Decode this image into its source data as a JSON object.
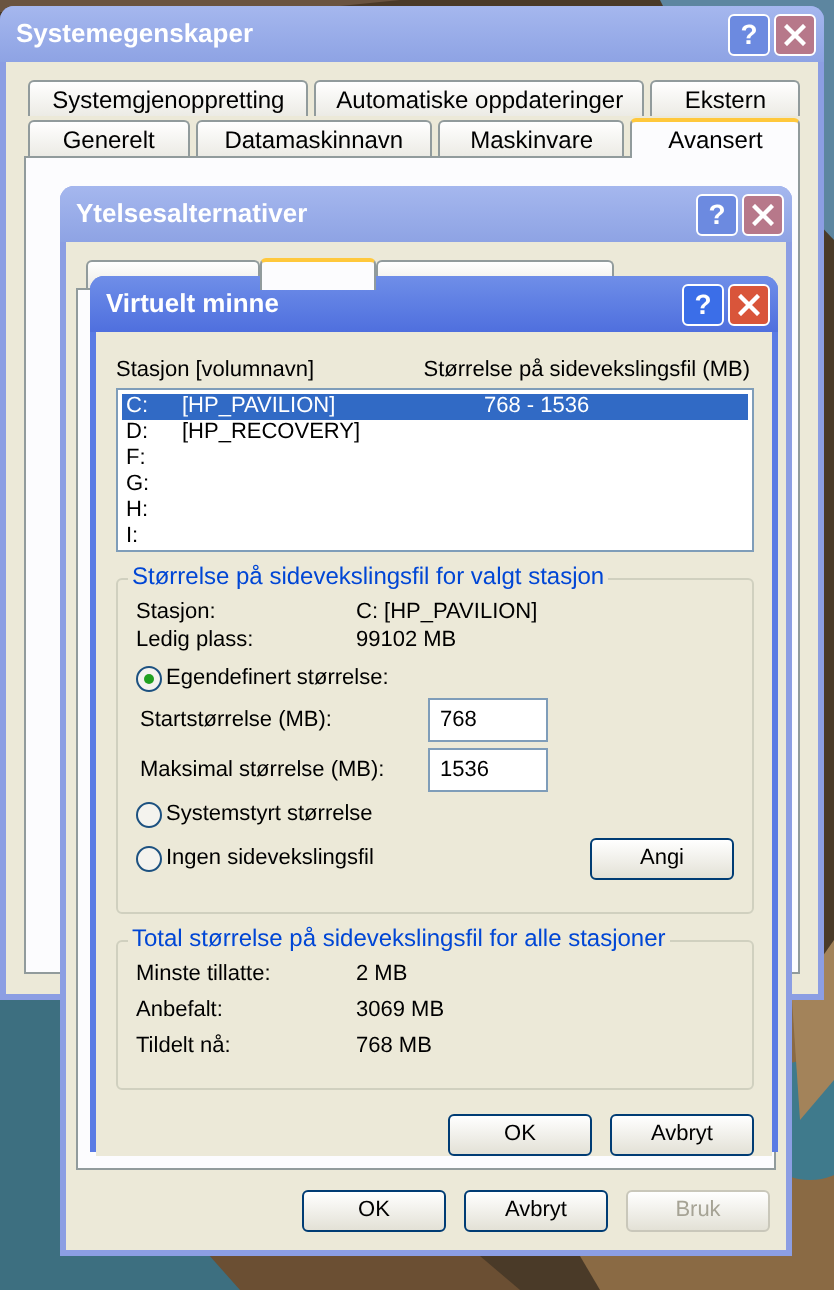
{
  "system_properties": {
    "title": "Systemegenskaper",
    "active": false,
    "help_button": "?",
    "tab_rows": [
      [
        {
          "label": "Systemgjenoppretting",
          "selected": false
        },
        {
          "label": "Automatiske oppdateringer",
          "selected": false
        },
        {
          "label": "Ekstern",
          "selected": false
        }
      ],
      [
        {
          "label": "Generelt",
          "selected": false
        },
        {
          "label": "Datamaskinnavn",
          "selected": false
        },
        {
          "label": "Maskinvare",
          "selected": false
        },
        {
          "label": "Avansert",
          "selected": true
        }
      ]
    ]
  },
  "performance_options": {
    "title": "Ytelsesalternativer",
    "active": false,
    "help_button": "?",
    "tabs": [
      {
        "selected": false
      },
      {
        "selected": true
      },
      {
        "selected": false
      }
    ],
    "buttons": [
      {
        "label": "OK",
        "disabled": false
      },
      {
        "label": "Avbryt",
        "disabled": false
      },
      {
        "label": "Bruk",
        "disabled": true
      }
    ]
  },
  "virtual_memory": {
    "title": "Virtuelt minne",
    "active": true,
    "help_button": "?",
    "columns": [
      "Stasjon [volumnavn]",
      "Størrelse på sidevekslingsfil (MB)"
    ],
    "drives": [
      {
        "drive": "C:",
        "volume": "[HP_PAVILION]",
        "size": "768 - 1536",
        "selected": true
      },
      {
        "drive": "D:",
        "volume": "[HP_RECOVERY]",
        "selected": false
      },
      {
        "drive": "F:",
        "selected": false
      },
      {
        "drive": "G:",
        "selected": false
      },
      {
        "drive": "H:",
        "selected": false
      },
      {
        "drive": "I:",
        "selected": false
      }
    ],
    "selected_drive_group": {
      "title": "Størrelse på sidevekslingsfil for valgt stasjon",
      "info": [
        {
          "label": "Stasjon:",
          "value": "C:  [HP_PAVILION]"
        },
        {
          "label": "Ledig plass:",
          "value": "99102 MB"
        }
      ],
      "options": [
        {
          "label": "Egendefinert størrelse:",
          "selected": true,
          "fields": [
            {
              "label": "Startstørrelse (MB):",
              "value": "768"
            },
            {
              "label": "Maksimal størrelse (MB):",
              "value": "1536"
            }
          ]
        },
        {
          "label": "Systemstyrt størrelse",
          "selected": false
        },
        {
          "label": "Ingen sidevekslingsfil",
          "selected": false
        }
      ],
      "set_button": "Angi"
    },
    "total_group": {
      "title": "Total størrelse på sidevekslingsfil for alle stasjoner",
      "info": [
        {
          "label": "Minste tillatte:",
          "value": "2 MB"
        },
        {
          "label": "Anbefalt:",
          "value": "3069 MB"
        },
        {
          "label": "Tildelt nå:",
          "value": "768 MB"
        }
      ]
    },
    "buttons": [
      {
        "label": "OK",
        "disabled": false
      },
      {
        "label": "Avbryt",
        "disabled": false
      }
    ]
  }
}
